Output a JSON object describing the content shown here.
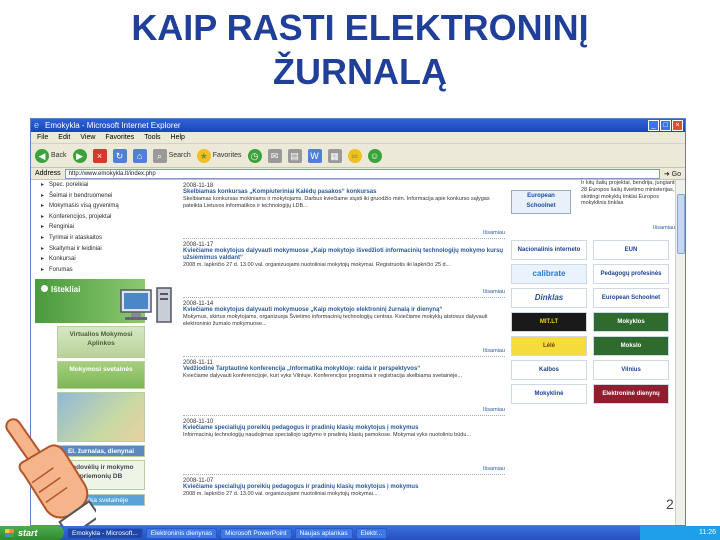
{
  "slide": {
    "title_line1": "KAIP RASTI ELEKTRONINĮ",
    "title_line2": "ŽURNALĄ",
    "page_number": "2",
    "title_color": "#1f3f99"
  },
  "browser": {
    "window_title": "Emokykla - Microsoft Internet Explorer",
    "menu": [
      "File",
      "Edit",
      "View",
      "Favorites",
      "Tools",
      "Help"
    ],
    "toolbar": {
      "back_label": "Back",
      "search_label": "Search",
      "favorites_label": "Favorites"
    },
    "address_label": "Address",
    "address_value": "http://www.emokykla.lt/index.php",
    "go_label": "Go"
  },
  "sidebar": {
    "nav_items": [
      "Spec. poreikiai",
      "Šeimai ir bendruomenei",
      "Mokymasis visą gyvenimą",
      "Konferencijos, projektai",
      "Renginiai",
      "Tyrimai ir ataskaitos",
      "Skaitymai ir leidiniai",
      "Konkursai",
      "Forumas"
    ],
    "istekliai_label": "Ištekliai",
    "vma_label": "Virtualios Mokymosi Aplinkos",
    "mokymosi_label": "Mokymosi svetainės",
    "ezurnalas_label": "El. žurnalas, dienynai",
    "vadoveliai_label": "Vadovėlių ir mokymo priemonių DB",
    "ieskok_label": "Paieška svetainėje"
  },
  "news": [
    {
      "date": "2008-11-18",
      "headline": "Skelbiamas konkursas „Kompiuteriniai Kalėdų pasakos“ konkursas",
      "body": "Skelbiamas konkursas mokiniams ir mokytojams. Darbus kviečiame siųsti iki gruodžio mėn. Informacija apie konkurso sąlygas pateikta Lietuvos informatikos ir technologijų LDB...",
      "more": "Išsamiau"
    },
    {
      "date": "2008-11-17",
      "headline": "Kviečiame mokytojus dalyvauti mokymuose „Kaip mokytojo išvedžioti informacinių technologijų mokymo kursų užsiėmimus valdant“",
      "body": "2008 m. lapkričio 27 d. 13.00 val. organizuojami nuotoliniai mokytojų mokymai. Registruotis iki lapkričio 25 d...",
      "more": "Išsamiau"
    },
    {
      "date": "2008-11-14",
      "headline": "Kviečiame mokytojus dalyvauti mokymuose „Kaip mokytojo elektroninį žurnalą ir dienyną“",
      "body": "Mokymus, skirtus mokytojams, organizuoja Švietimo informacinių technologijų centras. Kviečiame mokyklų atstovus dalyvauti elektroninio žurnalo mokymuose...",
      "more": "Išsamiau"
    },
    {
      "date": "2008-11-11",
      "headline": "Vedžiodinė Tarptautinė konferencija „Informatika mokykloje: raida ir perspektyvos“",
      "body": "Kviečiame dalyvauti konferencijoje, kuri vyks Vilniuje. Konferencijos programa ir registracija skelbiama svetainėje...",
      "more": "Išsamiau"
    },
    {
      "date": "2008-11-10",
      "headline": "Kviečiame specialiųjų poreikių pedagogus ir pradinių klasių mokytojus į mokymus",
      "body": "Informacinių technologijų naudojimas specialiojo ugdymo ir pradinių klasių pamokose. Mokymai vyks nuotoliniu būdu...",
      "more": "Išsamiau"
    },
    {
      "date": "2008-11-07",
      "headline": "Kviečiame specialiųjų poreikių pedagogus ir pradinių klasių mokytojus į mokymus",
      "body": "2008 m. lapkričio 27 d. 13.00 val. organizuojami nuotoliniai mokytojų mokymai...",
      "more": ""
    }
  ],
  "rightcol": {
    "eu_logo": "European Schoolnet",
    "top_text": "Ir kitų šalių projektai, bendrija, jungiantis 28 Europos šalių švietimo ministerijas, skirtingi mokyklų tinklai Europos mokyklinis tinklas",
    "more": "Išsamiau",
    "logos": [
      "Nacionalinis interneto mokyklų tinklas",
      "EUN",
      "calibrate",
      "Pedagogų profesinės raidos centras",
      "Dinklas",
      "European Schoolnet",
      "MIT.LT",
      "Mokyklos",
      "Lėlė",
      "Mokslo",
      "Kalbos",
      "Vilnius",
      "Mokyklinė",
      "Elektroninė dienynų knyga"
    ]
  },
  "taskbar": {
    "start_label": "start",
    "tasks": [
      "Emokykla - Microsoft...",
      "Elektroninis dienynas",
      "Microsoft PowerPoint",
      "Naujas aplankas",
      "Elektr..."
    ],
    "clock": "11:26"
  }
}
